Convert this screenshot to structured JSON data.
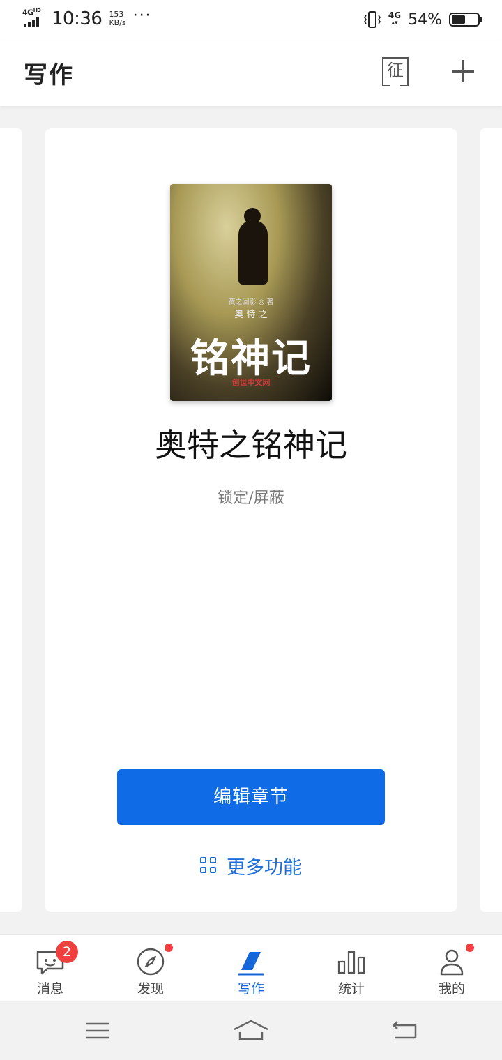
{
  "status_bar": {
    "network_type": "4G",
    "network_hd": "HD",
    "time": "10:36",
    "speed_value": "153",
    "speed_unit": "KB/s",
    "more": "···",
    "network_type_right": "4G",
    "battery_percent": "54%",
    "battery_level": 0.54
  },
  "header": {
    "title": "写作",
    "zheng_label": "征"
  },
  "book": {
    "cover": {
      "author_line": "夜之回影 ◎ 著",
      "series_line": "奥 特 之",
      "big_title": "铭神记",
      "publisher": "创世中文网"
    },
    "title": "奥特之铭神记",
    "status": "锁定/屏蔽",
    "edit_button": "编辑章节",
    "more_functions": "更多功能"
  },
  "tabbar": {
    "items": [
      {
        "label": "消息",
        "icon": "message-icon",
        "badge": "2"
      },
      {
        "label": "发现",
        "icon": "compass-icon",
        "dot": true
      },
      {
        "label": "写作",
        "icon": "pen-icon",
        "active": true
      },
      {
        "label": "统计",
        "icon": "bar-chart-icon"
      },
      {
        "label": "我的",
        "icon": "person-icon",
        "dot": true
      }
    ]
  },
  "colors": {
    "accent": "#0f6ce6",
    "link": "#1f6fd9",
    "badge": "#ef4040"
  }
}
